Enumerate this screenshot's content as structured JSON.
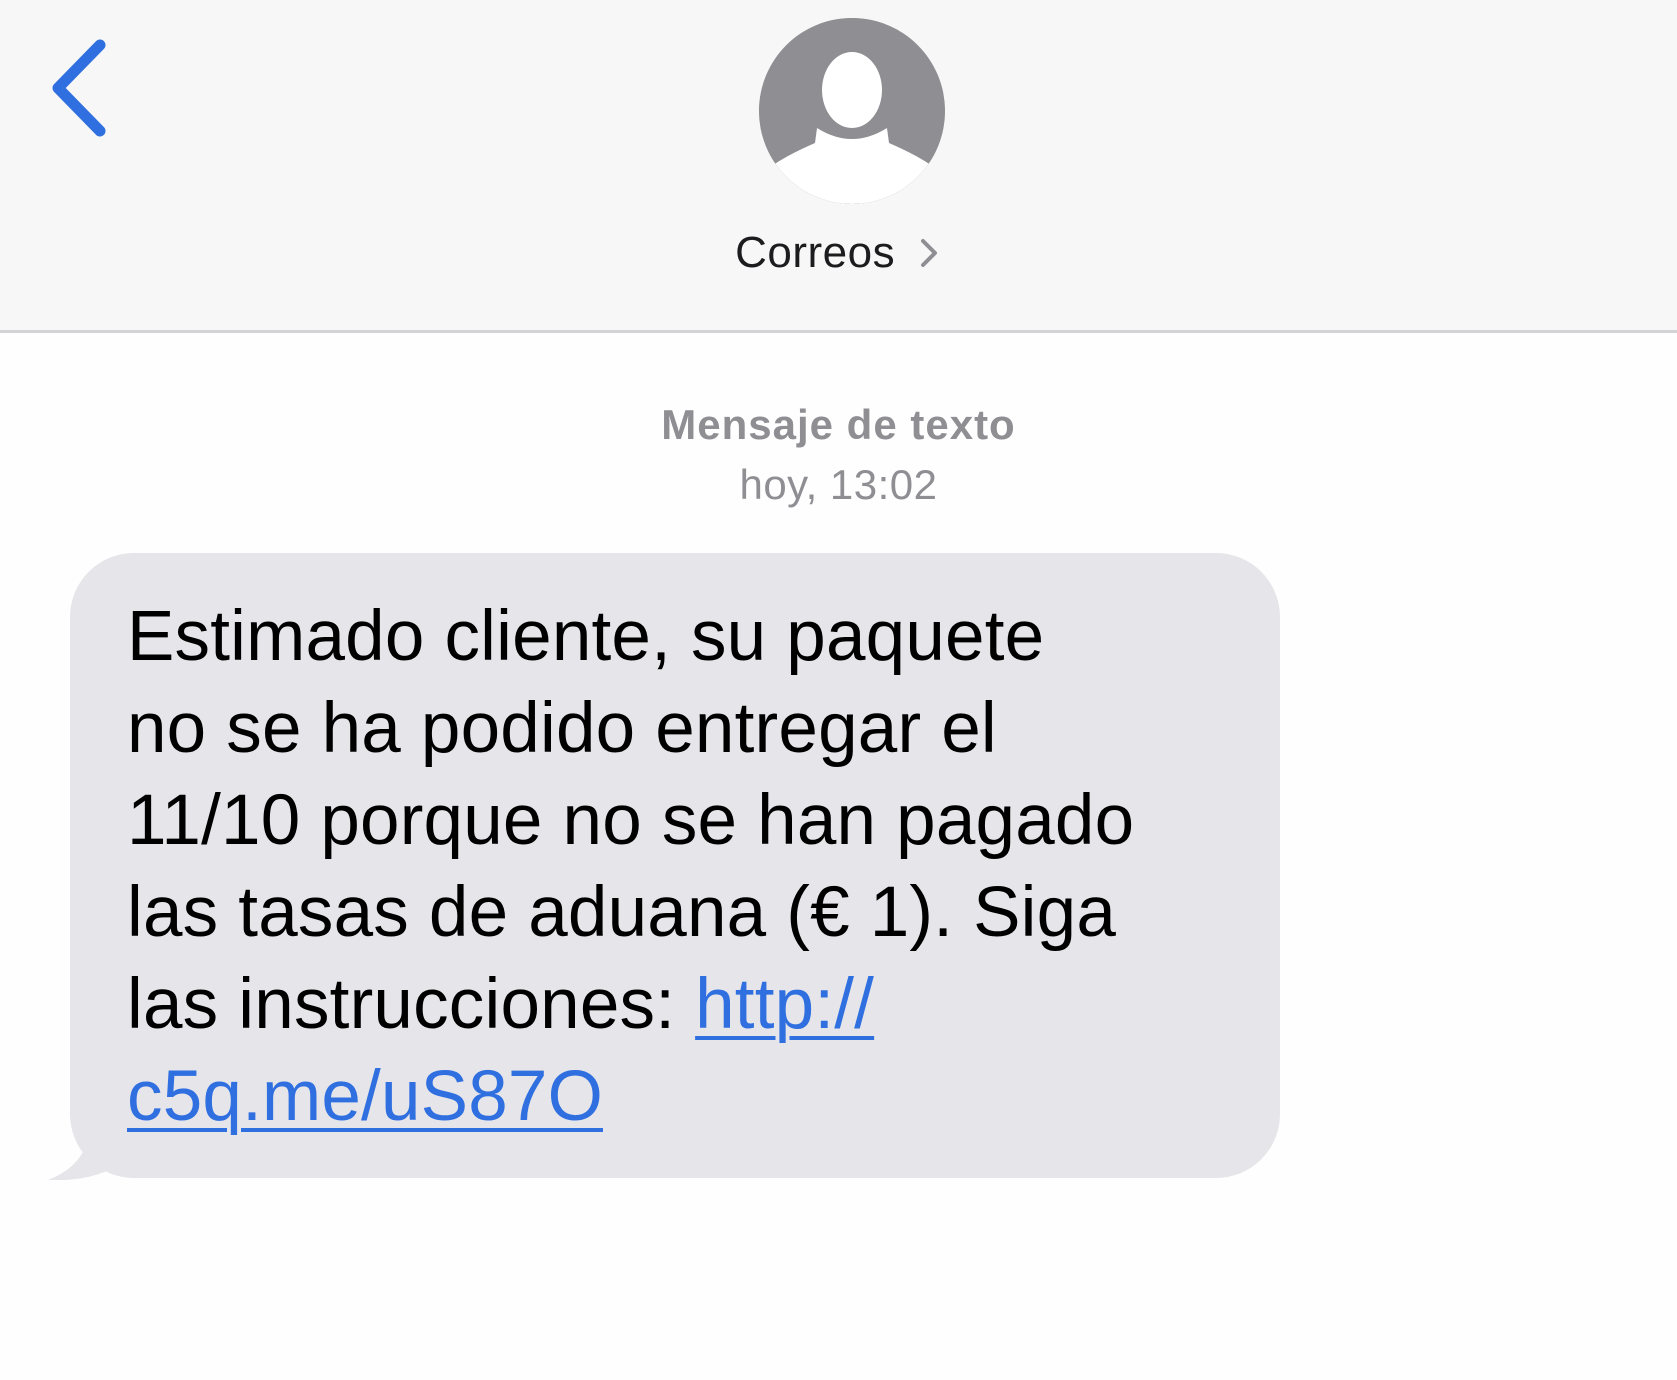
{
  "header": {
    "contact_name": "Correos",
    "back_icon": "chevron-left-icon",
    "avatar_icon": "person-silhouette-icon",
    "accent_color": "#2f6fe0"
  },
  "thread": {
    "message_type": "Mensaje de texto",
    "timestamp": "hoy, 13:02"
  },
  "message": {
    "text_lines": [
      "Estimado cliente, su paquete",
      "no se ha podido entregar el",
      "11/10 porque no se han pagado",
      "las tasas de aduana (€ 1). Siga",
      "las instrucciones: "
    ],
    "link_part1": "http://",
    "link_part2": "c5q.me/uS87O",
    "bubble_color": "#e5e5ea"
  }
}
